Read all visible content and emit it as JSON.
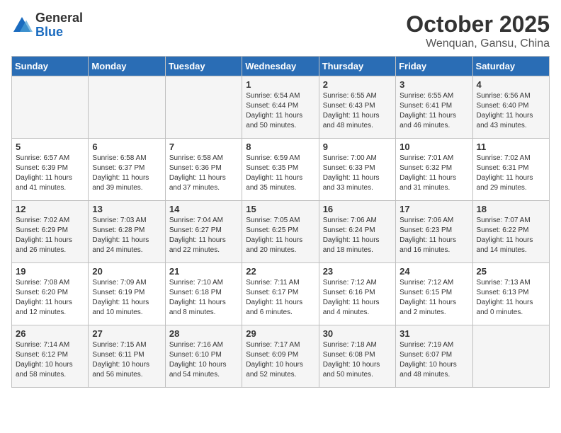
{
  "logo": {
    "general": "General",
    "blue": "Blue"
  },
  "title": "October 2025",
  "location": "Wenquan, Gansu, China",
  "days_of_week": [
    "Sunday",
    "Monday",
    "Tuesday",
    "Wednesday",
    "Thursday",
    "Friday",
    "Saturday"
  ],
  "weeks": [
    [
      {
        "day": "",
        "info": ""
      },
      {
        "day": "",
        "info": ""
      },
      {
        "day": "",
        "info": ""
      },
      {
        "day": "1",
        "info": "Sunrise: 6:54 AM\nSunset: 6:44 PM\nDaylight: 11 hours\nand 50 minutes."
      },
      {
        "day": "2",
        "info": "Sunrise: 6:55 AM\nSunset: 6:43 PM\nDaylight: 11 hours\nand 48 minutes."
      },
      {
        "day": "3",
        "info": "Sunrise: 6:55 AM\nSunset: 6:41 PM\nDaylight: 11 hours\nand 46 minutes."
      },
      {
        "day": "4",
        "info": "Sunrise: 6:56 AM\nSunset: 6:40 PM\nDaylight: 11 hours\nand 43 minutes."
      }
    ],
    [
      {
        "day": "5",
        "info": "Sunrise: 6:57 AM\nSunset: 6:39 PM\nDaylight: 11 hours\nand 41 minutes."
      },
      {
        "day": "6",
        "info": "Sunrise: 6:58 AM\nSunset: 6:37 PM\nDaylight: 11 hours\nand 39 minutes."
      },
      {
        "day": "7",
        "info": "Sunrise: 6:58 AM\nSunset: 6:36 PM\nDaylight: 11 hours\nand 37 minutes."
      },
      {
        "day": "8",
        "info": "Sunrise: 6:59 AM\nSunset: 6:35 PM\nDaylight: 11 hours\nand 35 minutes."
      },
      {
        "day": "9",
        "info": "Sunrise: 7:00 AM\nSunset: 6:33 PM\nDaylight: 11 hours\nand 33 minutes."
      },
      {
        "day": "10",
        "info": "Sunrise: 7:01 AM\nSunset: 6:32 PM\nDaylight: 11 hours\nand 31 minutes."
      },
      {
        "day": "11",
        "info": "Sunrise: 7:02 AM\nSunset: 6:31 PM\nDaylight: 11 hours\nand 29 minutes."
      }
    ],
    [
      {
        "day": "12",
        "info": "Sunrise: 7:02 AM\nSunset: 6:29 PM\nDaylight: 11 hours\nand 26 minutes."
      },
      {
        "day": "13",
        "info": "Sunrise: 7:03 AM\nSunset: 6:28 PM\nDaylight: 11 hours\nand 24 minutes."
      },
      {
        "day": "14",
        "info": "Sunrise: 7:04 AM\nSunset: 6:27 PM\nDaylight: 11 hours\nand 22 minutes."
      },
      {
        "day": "15",
        "info": "Sunrise: 7:05 AM\nSunset: 6:25 PM\nDaylight: 11 hours\nand 20 minutes."
      },
      {
        "day": "16",
        "info": "Sunrise: 7:06 AM\nSunset: 6:24 PM\nDaylight: 11 hours\nand 18 minutes."
      },
      {
        "day": "17",
        "info": "Sunrise: 7:06 AM\nSunset: 6:23 PM\nDaylight: 11 hours\nand 16 minutes."
      },
      {
        "day": "18",
        "info": "Sunrise: 7:07 AM\nSunset: 6:22 PM\nDaylight: 11 hours\nand 14 minutes."
      }
    ],
    [
      {
        "day": "19",
        "info": "Sunrise: 7:08 AM\nSunset: 6:20 PM\nDaylight: 11 hours\nand 12 minutes."
      },
      {
        "day": "20",
        "info": "Sunrise: 7:09 AM\nSunset: 6:19 PM\nDaylight: 11 hours\nand 10 minutes."
      },
      {
        "day": "21",
        "info": "Sunrise: 7:10 AM\nSunset: 6:18 PM\nDaylight: 11 hours\nand 8 minutes."
      },
      {
        "day": "22",
        "info": "Sunrise: 7:11 AM\nSunset: 6:17 PM\nDaylight: 11 hours\nand 6 minutes."
      },
      {
        "day": "23",
        "info": "Sunrise: 7:12 AM\nSunset: 6:16 PM\nDaylight: 11 hours\nand 4 minutes."
      },
      {
        "day": "24",
        "info": "Sunrise: 7:12 AM\nSunset: 6:15 PM\nDaylight: 11 hours\nand 2 minutes."
      },
      {
        "day": "25",
        "info": "Sunrise: 7:13 AM\nSunset: 6:13 PM\nDaylight: 11 hours\nand 0 minutes."
      }
    ],
    [
      {
        "day": "26",
        "info": "Sunrise: 7:14 AM\nSunset: 6:12 PM\nDaylight: 10 hours\nand 58 minutes."
      },
      {
        "day": "27",
        "info": "Sunrise: 7:15 AM\nSunset: 6:11 PM\nDaylight: 10 hours\nand 56 minutes."
      },
      {
        "day": "28",
        "info": "Sunrise: 7:16 AM\nSunset: 6:10 PM\nDaylight: 10 hours\nand 54 minutes."
      },
      {
        "day": "29",
        "info": "Sunrise: 7:17 AM\nSunset: 6:09 PM\nDaylight: 10 hours\nand 52 minutes."
      },
      {
        "day": "30",
        "info": "Sunrise: 7:18 AM\nSunset: 6:08 PM\nDaylight: 10 hours\nand 50 minutes."
      },
      {
        "day": "31",
        "info": "Sunrise: 7:19 AM\nSunset: 6:07 PM\nDaylight: 10 hours\nand 48 minutes."
      },
      {
        "day": "",
        "info": ""
      }
    ]
  ]
}
